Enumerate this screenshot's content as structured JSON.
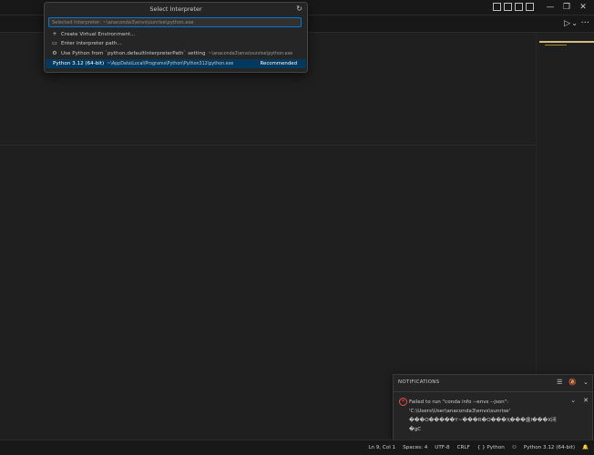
{
  "window": {
    "minimize_glyph": "—",
    "maximize_glyph": "❐",
    "close_glyph": "✕"
  },
  "editor": {
    "run_glyph": "▷",
    "run_menu_glyph": "⌄",
    "more_glyph": "···"
  },
  "quick_pick": {
    "title": "Select Interpreter",
    "refresh_glyph": "↻",
    "input_placeholder": "Selected Interpreter: ~\\anaconda3\\envs\\sunrise\\python.exe",
    "items": [
      {
        "icon": "plus-icon",
        "glyph": "+",
        "label": "Create Virtual Environment...",
        "description": ""
      },
      {
        "icon": "folder-icon",
        "glyph": "▭",
        "label": "Enter interpreter path...",
        "description": ""
      },
      {
        "icon": "gear-icon",
        "glyph": "⚙",
        "label": "Use Python from `python.defaultInterpreterPath` setting",
        "description": "~\\anaconda3\\envs\\sunrise\\python.exe"
      },
      {
        "icon": "",
        "glyph": "",
        "label": "Python 3.12 (64-bit)",
        "description": "~\\AppData\\Local\\Programs\\Python\\Python312\\python.exe",
        "badge": "Recommended"
      }
    ]
  },
  "notifications": {
    "title": "NOTIFICATIONS",
    "actions": {
      "clear_all": "☰",
      "dnd": "🔕",
      "collapse": "⌄"
    },
    "item": {
      "error_glyph": "✕",
      "lines": [
        "Failed to run \"conda info --envs --json\":",
        "'C:\\Users\\User\\anaconda3\\envs\\sunrise'",
        "���O�����Y~���R�O���Ҳ���䖒l���X闭",
        "�gC"
      ],
      "expand_glyph": "⌄",
      "close_glyph": "✕"
    }
  },
  "statusbar": {
    "position": "Ln 9, Col 1",
    "spaces": "Spaces: 4",
    "encoding": "UTF-8",
    "eol": "CRLF",
    "language": "{ } Python",
    "copilot_glyph": "⚇",
    "interpreter": "Python 3.12 (64-bit)",
    "bell_glyph": "🔔"
  }
}
